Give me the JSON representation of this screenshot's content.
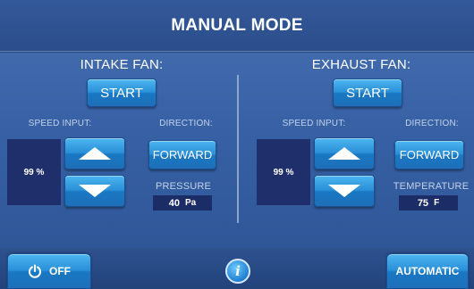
{
  "header": {
    "title": "MANUAL MODE"
  },
  "intake": {
    "title": "INTAKE FAN:",
    "start_label": "START",
    "speed_label": "SPEED INPUT:",
    "speed_value": "99 %",
    "direction_label": "DIRECTION:",
    "direction_value": "FORWARD",
    "sensor_label": "PRESSURE",
    "sensor_value": "40",
    "sensor_unit": "Pa"
  },
  "exhaust": {
    "title": "EXHAUST FAN:",
    "start_label": "START",
    "speed_label": "SPEED INPUT:",
    "speed_value": "99 %",
    "direction_label": "DIRECTION:",
    "direction_value": "FORWARD",
    "sensor_label": "TEMPERATURE",
    "sensor_value": "75",
    "sensor_unit": "F"
  },
  "footer": {
    "off_label": "OFF",
    "automatic_label": "AUTOMATIC",
    "icons": {
      "power": "power-icon",
      "info": "info-icon"
    }
  },
  "colors": {
    "accent": "#2a8fd8",
    "panel": "#3761a4",
    "readout_bg": "#1c2c66"
  }
}
